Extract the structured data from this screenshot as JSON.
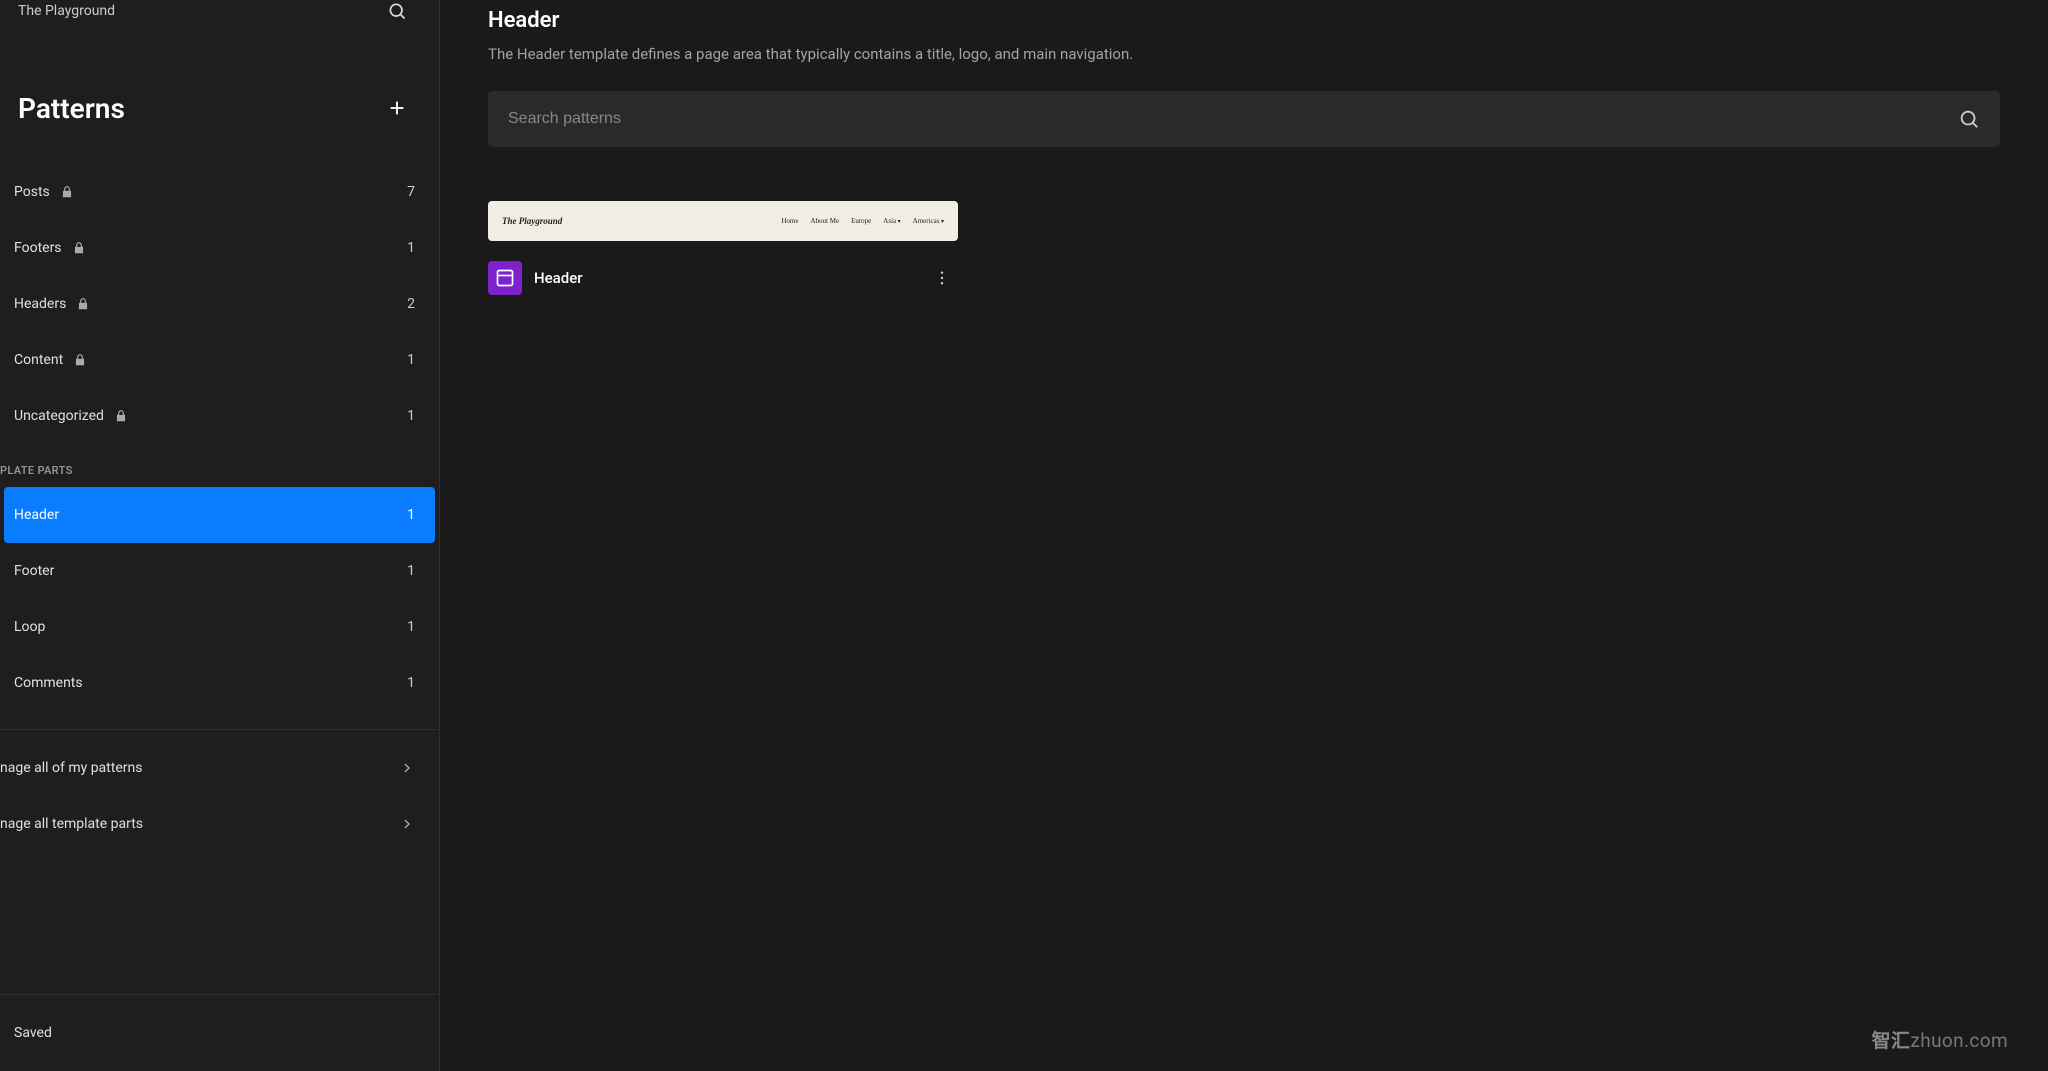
{
  "site_title": "The Playground",
  "sidebar": {
    "heading": "Patterns",
    "group1_title": "",
    "group2_title": "PLATE PARTS",
    "categories": [
      {
        "label": "Posts",
        "count": "7",
        "locked": true
      },
      {
        "label": "Footers",
        "count": "1",
        "locked": true
      },
      {
        "label": "Headers",
        "count": "2",
        "locked": true
      },
      {
        "label": "Content",
        "count": "1",
        "locked": true
      },
      {
        "label": "Uncategorized",
        "count": "1",
        "locked": true
      }
    ],
    "template_parts": [
      {
        "label": "Header",
        "count": "1",
        "active": true
      },
      {
        "label": "Footer",
        "count": "1"
      },
      {
        "label": "Loop",
        "count": "1"
      },
      {
        "label": "Comments",
        "count": "1"
      }
    ],
    "links": [
      {
        "label": "nage all of my patterns"
      },
      {
        "label": "nage all template parts"
      }
    ],
    "saved": "Saved"
  },
  "main": {
    "title": "Header",
    "subtitle": "The Header template defines a page area that typically contains a title, logo, and main navigation.",
    "search_placeholder": "Search patterns",
    "pattern": {
      "site_name": "The Playground",
      "nav": [
        "Home",
        "About Me",
        "Europe",
        "Asia",
        "Americas"
      ],
      "label": "Header"
    }
  },
  "watermark": {
    "a": "智汇",
    "b": "zhuon.com"
  }
}
